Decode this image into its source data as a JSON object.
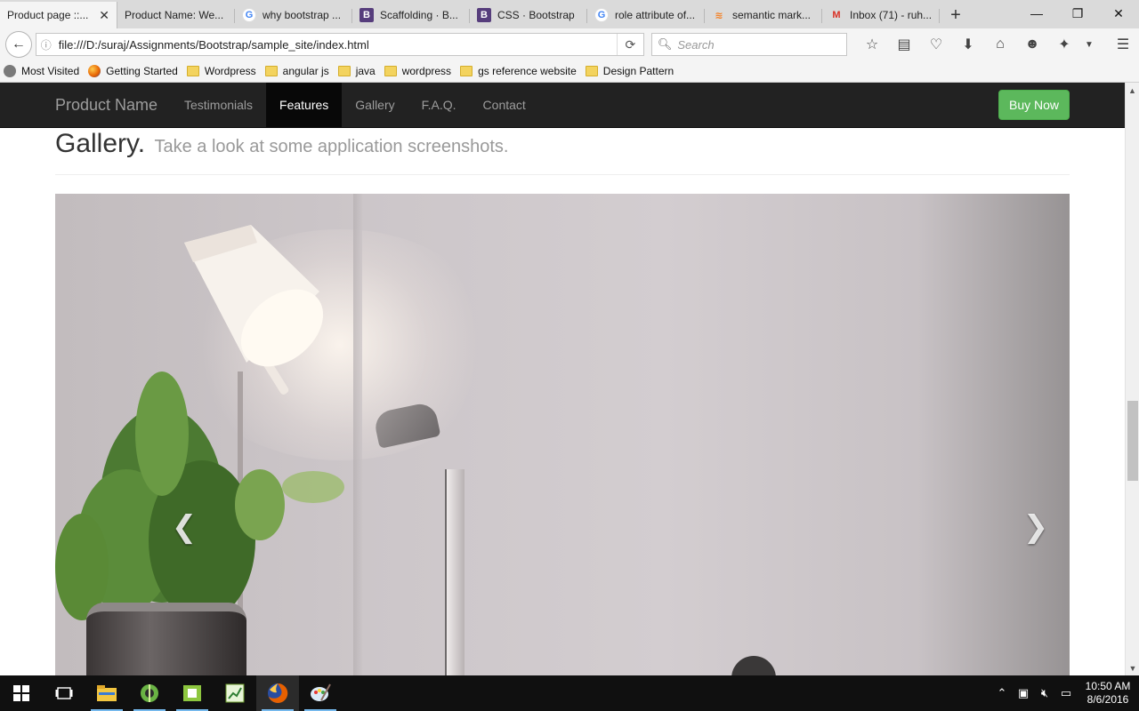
{
  "browser": {
    "tabs": [
      {
        "title": "Product page ::...",
        "favicon": "none",
        "active": true
      },
      {
        "title": "Product Name: We...",
        "favicon": "none",
        "active": false
      },
      {
        "title": "why bootstrap ...",
        "favicon": "google-icon",
        "active": false
      },
      {
        "title": "Scaffolding · B...",
        "favicon": "bootstrap-icon",
        "active": false
      },
      {
        "title": "CSS · Bootstrap",
        "favicon": "bootstrap-icon",
        "active": false
      },
      {
        "title": "role attribute of...",
        "favicon": "google-icon",
        "active": false
      },
      {
        "title": "semantic mark...",
        "favicon": "stackoverflow-icon",
        "active": false
      },
      {
        "title": "Inbox (71) - ruh...",
        "favicon": "gmail-icon",
        "active": false
      }
    ],
    "url": "file:///D:/suraj/Assignments/Bootstrap/sample_site/index.html",
    "search_placeholder": "Search",
    "bookmarks": [
      {
        "label": "Most Visited",
        "icon": "gear-icon"
      },
      {
        "label": "Getting Started",
        "icon": "firefox-icon"
      },
      {
        "label": "Wordpress",
        "icon": "folder-icon"
      },
      {
        "label": "angular js",
        "icon": "folder-icon"
      },
      {
        "label": "java",
        "icon": "folder-icon"
      },
      {
        "label": "wordpress",
        "icon": "folder-icon"
      },
      {
        "label": "gs reference website",
        "icon": "folder-icon"
      },
      {
        "label": "Design Pattern",
        "icon": "folder-icon"
      }
    ]
  },
  "site": {
    "brand": "Product Name",
    "nav": [
      {
        "label": "Testimonials",
        "active": false
      },
      {
        "label": "Features",
        "active": true
      },
      {
        "label": "Gallery",
        "active": false
      },
      {
        "label": "F.A.Q.",
        "active": false
      },
      {
        "label": "Contact",
        "active": false
      }
    ],
    "buy_button": "Buy Now",
    "buy_color": "#5cb85c",
    "navbar_color": "#222222",
    "header": {
      "title": "Gallery.",
      "subtitle": "Take a look at some application screenshots."
    },
    "carousel": {
      "prev_icon": "chevron-left-icon",
      "next_icon": "chevron-right-icon"
    }
  },
  "taskbar": {
    "time": "10:50 AM",
    "date": "8/6/2016",
    "apps": [
      "start-icon",
      "task-view-icon",
      "file-explorer-icon",
      "android-studio-icon",
      "notepad-icon",
      "excel-icon",
      "firefox-icon",
      "paint-icon"
    ]
  }
}
